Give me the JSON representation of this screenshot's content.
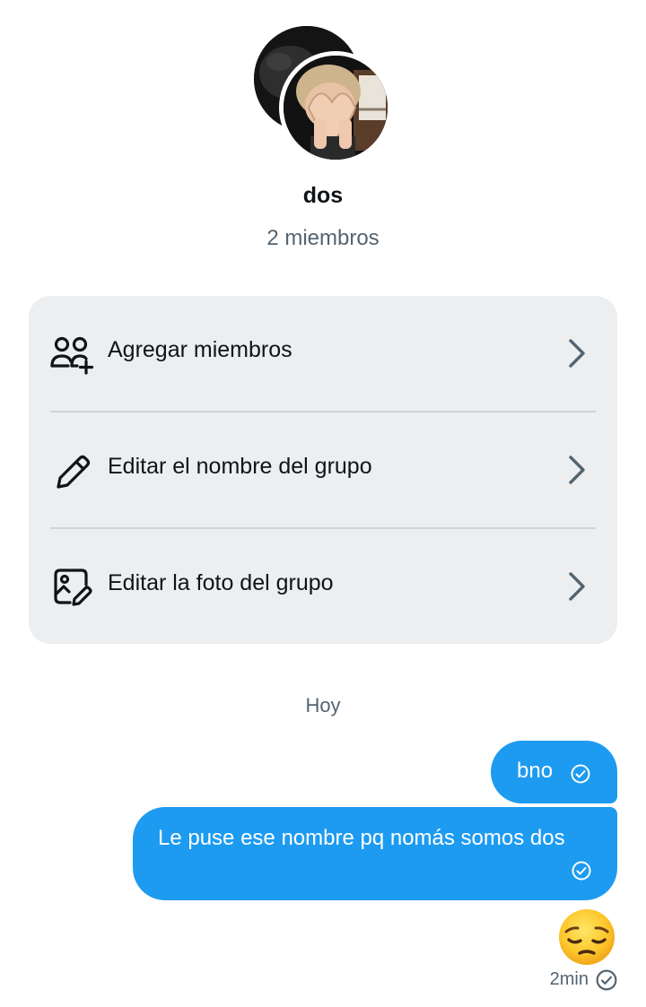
{
  "group": {
    "name": "dos",
    "members_text": "2 miembros"
  },
  "options": [
    {
      "label": "Agregar miembros",
      "icon": "add-members-icon"
    },
    {
      "label": "Editar el nombre del grupo",
      "icon": "pencil-icon"
    },
    {
      "label": "Editar la foto del grupo",
      "icon": "edit-photo-icon"
    }
  ],
  "conversation": {
    "day_label": "Hoy",
    "messages": [
      {
        "text": "bno",
        "status_icon": "sent-check-icon"
      },
      {
        "text": "Le puse ese nombre pq nomás somos dos",
        "status_icon": "sent-check-icon"
      },
      {
        "emoji": "pensive-face",
        "status_icon": "sent-check-icon"
      }
    ],
    "last_time": "2min"
  },
  "colors": {
    "accent": "#1d9bf0",
    "card_bg": "#eceef0",
    "secondary_text": "#536471",
    "primary_text": "#0f1419"
  }
}
